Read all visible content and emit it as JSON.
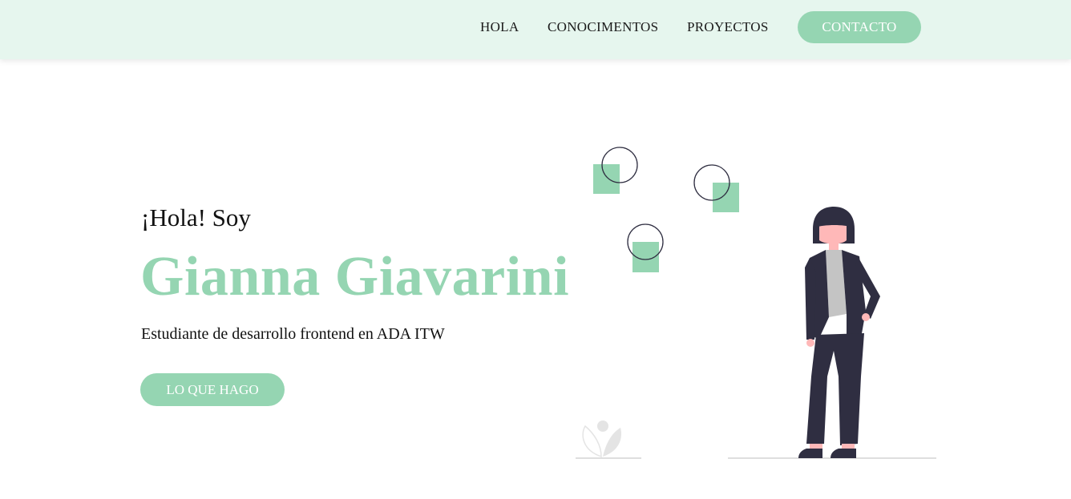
{
  "nav": {
    "links": [
      "HOLA",
      "CONOCIMENTOS",
      "PROYECTOS"
    ],
    "contact_label": "CONTACTO"
  },
  "hero": {
    "greeting": "¡Hola! Soy",
    "name": "Gianna Giavarini",
    "subtitle": "Estudiante de desarrollo frontend en ADA ITW",
    "cta_label": "LO QUE HAGO"
  },
  "colors": {
    "accent": "#95d5b2",
    "nav_bg": "#e6f6ee",
    "figure_dark": "#2f2e41",
    "skin": "#ffb8b8"
  }
}
